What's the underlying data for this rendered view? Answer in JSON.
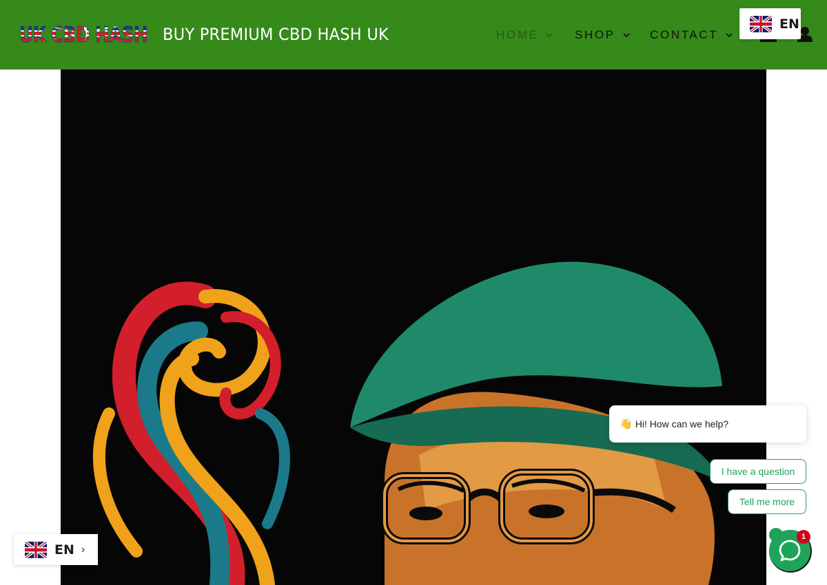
{
  "header": {
    "logo_text": "UK CBD HASH",
    "tagline": "BUY PREMIUM CBD HASH UK",
    "nav": [
      {
        "label": "HOME"
      },
      {
        "label": "SHOP"
      },
      {
        "label": "CONTACT"
      }
    ],
    "icons": [
      "chevron-down-icon",
      "cart-icon",
      "account-icon"
    ]
  },
  "language": {
    "top_code": "EN",
    "bottom_code": "EN",
    "arrow": "›",
    "flag_icon": "uk-flag-icon"
  },
  "chat": {
    "wave_emoji": "👋",
    "greeting": "Hi! How can we help?",
    "options": [
      "I have a question",
      "Tell me more"
    ],
    "badge_count": "1",
    "launcher_icon": "chat-bubble-icon"
  },
  "colors": {
    "header_bg": "#358a19",
    "accent_green": "#1fa35b",
    "badge_red": "#d0021b"
  }
}
